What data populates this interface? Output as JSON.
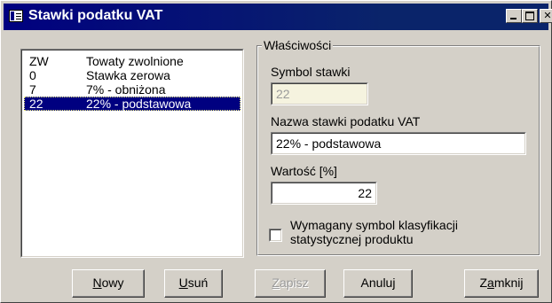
{
  "window": {
    "title": "Stawki podatku VAT",
    "minimize_label": "",
    "maximize_label": "",
    "close_label": "✕"
  },
  "rates_list": [
    {
      "symbol": "ZW",
      "name": "Towaty zwolnione",
      "selected": false
    },
    {
      "symbol": "0",
      "name": "Stawka zerowa",
      "selected": false
    },
    {
      "symbol": "7",
      "name": "7% - obniżona",
      "selected": false
    },
    {
      "symbol": "22",
      "name": "22% - podstawowa",
      "selected": true
    }
  ],
  "properties": {
    "legend": "Właściwości",
    "symbol_label": "Symbol stawki",
    "symbol_value": "22",
    "name_label": "Nazwa stawki podatku VAT",
    "name_value": "22% - podstawowa",
    "value_label": "Wartość [%]",
    "value_value": "22",
    "checkbox_label_line1": "Wymagany symbol klasyfikacji",
    "checkbox_label_line2": "statystycznej produktu",
    "checkbox_checked": false
  },
  "buttons": {
    "new": {
      "accel": "N",
      "rest": "owy"
    },
    "delete": {
      "accel": "U",
      "rest": "suń"
    },
    "save": {
      "accel": "Z",
      "rest": "apisz"
    },
    "cancel": {
      "label": "Anuluj"
    },
    "close": {
      "pre": "Z",
      "accel": "a",
      "rest": "mknij"
    }
  },
  "colors": {
    "title_bar": "#0a246a",
    "selection": "#000080",
    "face": "#d4d0c8"
  }
}
